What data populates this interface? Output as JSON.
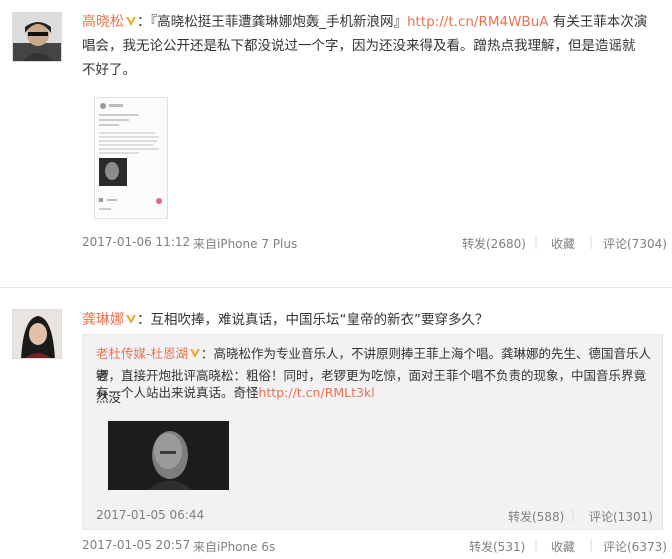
{
  "post1": {
    "author": "高晓松",
    "text_prefix": "：『高晓松挺王菲遭龚琳娜炮轰_手机新浪网』",
    "link": "http://t.cn/RM4WBuA",
    "text_line1_suffix": " 有关王菲本次演",
    "text_line2": "唱会，我无论公开还是私下都没说过一个字，因为还没来得及看。蹭热点我理解，但是造谣就",
    "text_line3": "不好了。",
    "time": "2017-01-06 11:12",
    "source": "来自iPhone 7 Plus",
    "repost": "转发(2680)",
    "favorite": "收藏",
    "comment": "评论(7304)"
  },
  "post2": {
    "author": "龚琳娜",
    "text": "：互相吹捧，难说真话，中国乐坛“皇帝的新衣”要穿多久？",
    "time": "2017-01-05 20:57",
    "source": "来自iPhone 6s",
    "repost": "转发(531)",
    "favorite": "收藏",
    "comment": "评论(6373)",
    "forwarded": {
      "author": "老杜传媒-杜恩湖",
      "line1": "：高晓松作为专业音乐人，不讲原则捧王菲上海个唱。龚琳娜的先生、德国音乐人老",
      "line2": "锣，直接开炮批评高晓松：粗俗！同时，老锣更为吃惊，面对王菲个唱不负责的现象，中国音乐界竟然没",
      "line3_prefix": "有一个人站出来说真话。奇怪",
      "link": "http://t.cn/RMLt3kl",
      "time": "2017-01-05 06:44",
      "repost": "转发(588)",
      "comment": "评论(1301)"
    }
  },
  "colors": {
    "accent": "#eb7350",
    "meta": "#808080",
    "repost_bg": "#f2f2f5"
  }
}
